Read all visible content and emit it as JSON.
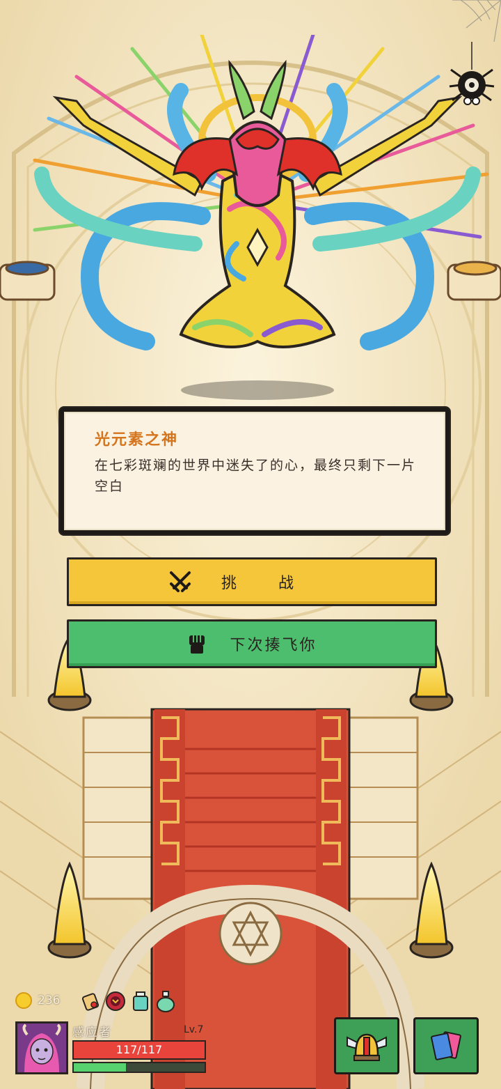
{
  "boss": {
    "name": "光元素之神",
    "description": "在七彩斑斓的世界中迷失了的心，最终只剩下一片空白"
  },
  "actions": {
    "challenge_label": "挑战",
    "flee_label": "下次揍飞你"
  },
  "player": {
    "gold": "236",
    "name": "感应者",
    "level": "Lv.7",
    "hp_text": "117/117",
    "hp_fraction": 1.0,
    "xp_fraction": 0.4
  },
  "inventory_items": [
    "scroll-icon",
    "demon-mask-icon",
    "jar-icon",
    "potion-icon"
  ],
  "icons": {
    "settings": "gear-spider-icon",
    "challenge": "crossed-swords-icon",
    "flee": "fist-icon",
    "equipment": "winged-helmet-icon",
    "deck": "cards-icon"
  },
  "colors": {
    "challenge_button": "#f5c63a",
    "flee_button": "#4dbd6e",
    "hp_bar": "#e8443c",
    "xp_bar": "#58d26f",
    "title": "#d4741c"
  }
}
